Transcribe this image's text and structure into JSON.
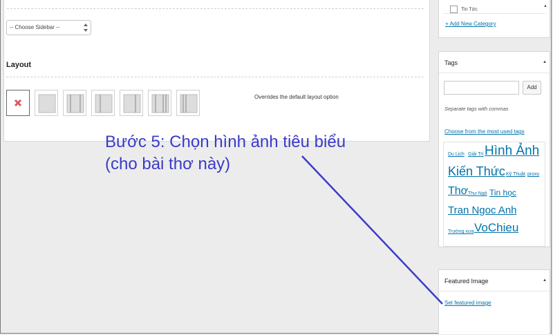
{
  "editor": {
    "sidebar_select": "-- Choose Sidebar --",
    "layout_heading": "Layout",
    "layout_hint": "Overrides the default layout option",
    "layout_options": [
      "none",
      "full-width",
      "three-columns",
      "left-sidebar",
      "right-sidebar",
      "sidebar-content-sidebar",
      "two-sidebars-left"
    ]
  },
  "categories": {
    "partial_item": "Tin Tức",
    "add_link": "+ Add New Category"
  },
  "tags": {
    "title": "Tags",
    "add_button": "Add",
    "hint": "Separate tags with commas",
    "choose_link": "Choose from the most used tags",
    "cloud": [
      "Du Lịch",
      "Giải Trí",
      "Hình Ảnh",
      "Kiến Thức",
      "Kỹ Thuật",
      "proxy",
      "Thơ",
      "Thư Ngỏ",
      "Tin học",
      "Tran Ngoc Anh",
      "Trường xưa",
      "VoChieu"
    ]
  },
  "featured_image": {
    "title": "Featured Image",
    "link": "Set featured image"
  },
  "annotation": {
    "line1": "Bước 5: Chọn hình ảnh tiêu biểu",
    "line2": "(cho bài thơ này)",
    "color": "#3a3ac9"
  }
}
